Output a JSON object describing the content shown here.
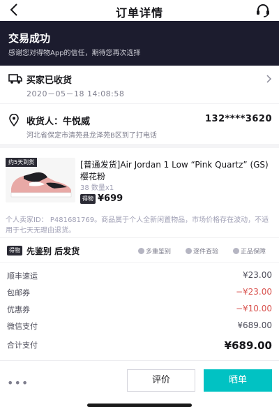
{
  "nav": {
    "title": "订单详情"
  },
  "banner": {
    "title": "交易成功",
    "subtitle": "感谢您对得物App的信任，期待您再次选择"
  },
  "shipping": {
    "title": "买家已收货",
    "time": "2020－05－18 14:08:58"
  },
  "address": {
    "name": "收货人：牛悦威",
    "phone": "132****3620",
    "detail": "河北省保定市清苑县龙泽苑B区到了打电话"
  },
  "product": {
    "ship_tag": "约5天到货",
    "name": "[普通发货]Air Jordan 1 Low “Pink Quartz” (GS) 樱花粉",
    "spec": "38  数量x1",
    "brand_tag": "得物",
    "price": "¥699",
    "notice": "个人卖家ID： P481681769。商品属于个人全新闲置物品，市场价格存在波动，不适用于七天无理由退货。"
  },
  "verify": {
    "badge": "得物",
    "title": "先鉴别 后发货",
    "features": [
      "多重鉴别",
      "逐件查验",
      "正品保障"
    ]
  },
  "fees": [
    {
      "label": "顺丰速运",
      "value": "¥23.00",
      "color": "#16161a"
    },
    {
      "label": "包邮券",
      "value": "−¥23.00",
      "color": "#d9534f"
    },
    {
      "label": "优惠券",
      "value": "−¥10.00",
      "color": "#d9534f"
    },
    {
      "label": "微信支付",
      "value": "¥689.00",
      "color": "#16161a"
    }
  ],
  "total": {
    "label": "合计支付",
    "value": "¥689.00"
  },
  "bottom": {
    "review": "评价",
    "share": "晒单",
    "accent": "#01c2c3"
  }
}
